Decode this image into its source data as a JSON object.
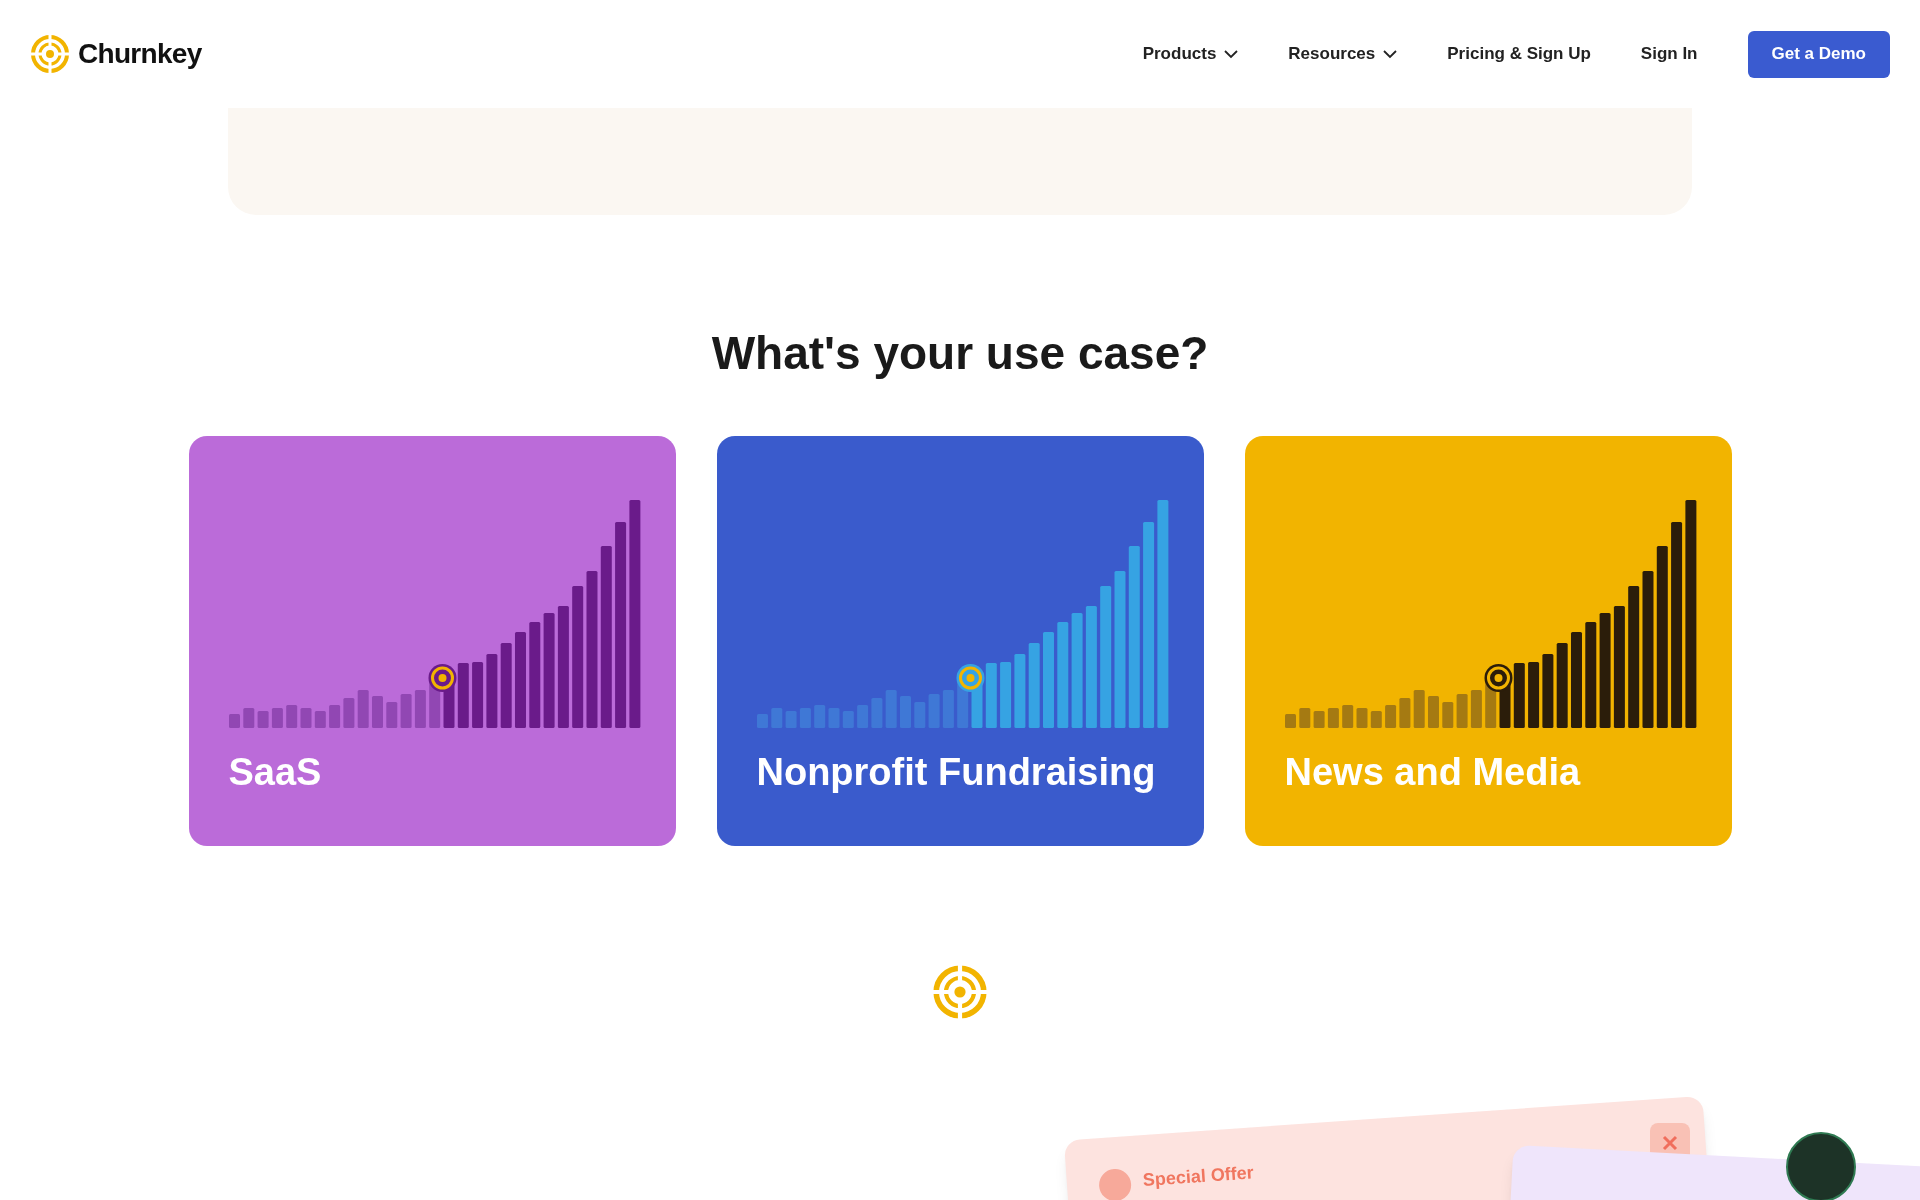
{
  "header": {
    "brand": "Churnkey",
    "nav": [
      {
        "label": "Products",
        "dropdown": true
      },
      {
        "label": "Resources",
        "dropdown": true
      },
      {
        "label": "Pricing & Sign Up",
        "dropdown": false
      },
      {
        "label": "Sign In",
        "dropdown": false
      }
    ],
    "cta": "Get a Demo"
  },
  "section": {
    "heading": "What's your use case?"
  },
  "cards": [
    {
      "title": "SaaS",
      "color": "#bb6bd9",
      "kind": "purple"
    },
    {
      "title": "Nonprofit Fundraising",
      "color": "#3a5bcc",
      "kind": "blue"
    },
    {
      "title": "News and Media",
      "color": "#f2b400",
      "kind": "gold"
    }
  ],
  "preview": {
    "offer_label": "Special Offer"
  }
}
